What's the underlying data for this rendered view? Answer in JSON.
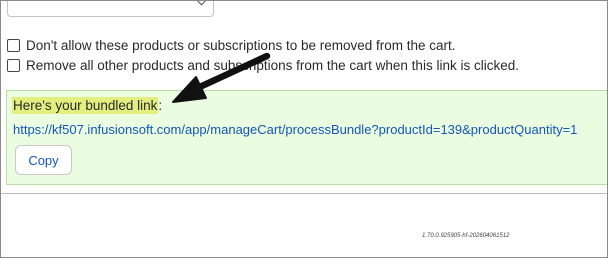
{
  "options": {
    "no_remove_label": "Don't allow these products or subscriptions to be removed from the cart.",
    "remove_others_label": "Remove all other products and subscriptions from the cart when this link is clicked."
  },
  "bundle": {
    "label": "Here's your bundled link",
    "label_suffix": ":",
    "url": "https://kf507.infusionsoft.com/app/manageCart/processBundle?productId=139&productQuantity=1",
    "copy_label": "Copy"
  },
  "footer": {
    "version": "1.70.0.925905-hf-202604061512"
  },
  "colors": {
    "panel_bg": "#eafde0",
    "highlight": "#e2ef7f",
    "link": "#1456b8",
    "annotation_arrow": "#111111"
  },
  "icons": {
    "annotation": "arrow-pointer-icon",
    "select": "chevron-down-icon"
  }
}
